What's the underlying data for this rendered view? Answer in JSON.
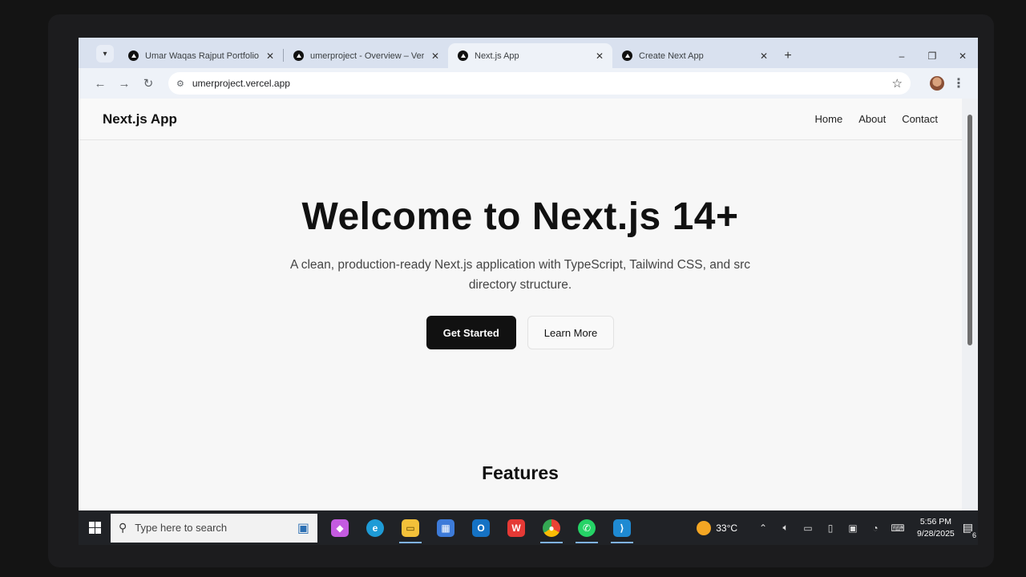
{
  "browser": {
    "tabs": [
      {
        "title": "Umar Waqas Rajput Portfolio",
        "active": false
      },
      {
        "title": "umerproject - Overview – Vercel",
        "active": false
      },
      {
        "title": "Next.js App",
        "active": true
      },
      {
        "title": "Create Next App",
        "active": false
      }
    ],
    "url": "umerproject.vercel.app"
  },
  "page": {
    "brand": "Next.js App",
    "nav": [
      "Home",
      "About",
      "Contact"
    ],
    "hero_title": "Welcome to Next.js 14+",
    "hero_subtitle": "A clean, production-ready Next.js application with TypeScript, Tailwind CSS, and src directory structure.",
    "primary_cta": "Get Started",
    "secondary_cta": "Learn More",
    "features_heading": "Features"
  },
  "taskbar": {
    "search_placeholder": "Type here to search",
    "weather": "33°C",
    "time": "5:56 PM",
    "date": "9/28/2025",
    "notifications": "6",
    "apps": [
      {
        "name": "copilot-icon",
        "color": "#c45be0"
      },
      {
        "name": "edge-icon",
        "color": "#1e9bd6"
      },
      {
        "name": "file-explorer-icon",
        "color": "#f3c13a"
      },
      {
        "name": "store-icon",
        "color": "#3d7bd9"
      },
      {
        "name": "outlook-icon",
        "color": "#1572c4"
      },
      {
        "name": "wps-office-icon",
        "color": "#e53935"
      },
      {
        "name": "chrome-icon",
        "color": "#34a853"
      },
      {
        "name": "whatsapp-icon",
        "color": "#25d366"
      },
      {
        "name": "vscode-icon",
        "color": "#1f8ad2"
      }
    ]
  }
}
